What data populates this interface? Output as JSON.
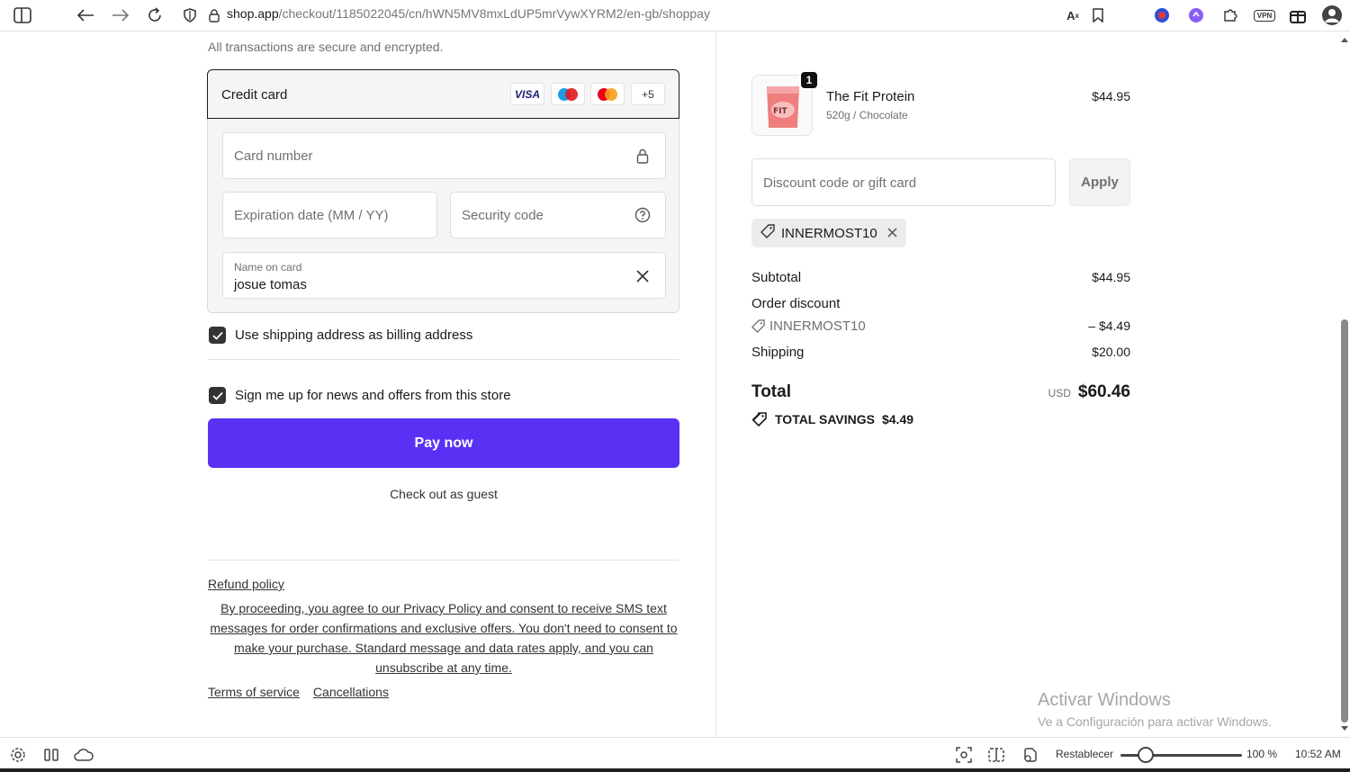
{
  "browser": {
    "url_host": "shop.app",
    "url_path": "/checkout/1185022045/cn/hWN5MV8mxLdUP5mrVywXYRM2/en-gb/shoppay"
  },
  "payment": {
    "secure_note": "All transactions are secure and encrypted.",
    "method_label": "Credit card",
    "card_brands": [
      "VISA",
      "maestro",
      "mastercard"
    ],
    "more_brands": "+5",
    "card_number_placeholder": "Card number",
    "expiration_placeholder": "Expiration date (MM / YY)",
    "security_code_placeholder": "Security code",
    "name_label": "Name on card",
    "name_value": "josue tomas"
  },
  "billing_checkbox": {
    "label": "Use shipping address as billing address",
    "checked": true
  },
  "news_checkbox": {
    "label": "Sign me up for news and offers from this store",
    "checked": true
  },
  "pay_button": {
    "label": "Pay now",
    "color": "#5a31f4"
  },
  "guest_link": "Check out as guest",
  "refund_link": "Refund policy",
  "legal_text": "By proceeding, you agree to our Privacy Policy and consent to receive SMS text messages for order confirmations and exclusive offers. You don't need to consent to make your purchase. Standard message and data rates apply, and you can unsubscribe at any time.",
  "footer_links": {
    "terms": "Terms of service",
    "cancellations": "Cancellations"
  },
  "summary": {
    "product": {
      "name": "The Fit Protein",
      "variant": "520g / Chocolate",
      "price": "$44.95",
      "quantity": "1"
    },
    "discount_placeholder": "Discount code or gift card",
    "apply_label": "Apply",
    "applied_code": "INNERMOST10",
    "subtotal_label": "Subtotal",
    "subtotal_value": "$44.95",
    "order_discount_label": "Order discount",
    "discount_code": "INNERMOST10",
    "discount_value": "– $4.49",
    "shipping_label": "Shipping",
    "shipping_value": "$20.00",
    "total_label": "Total",
    "currency": "USD",
    "total_value": "$60.46",
    "savings_label": "TOTAL SAVINGS",
    "savings_value": "$4.49"
  },
  "windows_watermark": {
    "line1": "Activar Windows",
    "line2": "Ve a Configuración para activar Windows."
  },
  "statusbar": {
    "restore_label": "Restablecer",
    "zoom": "100 %",
    "time": "10:52 AM"
  }
}
